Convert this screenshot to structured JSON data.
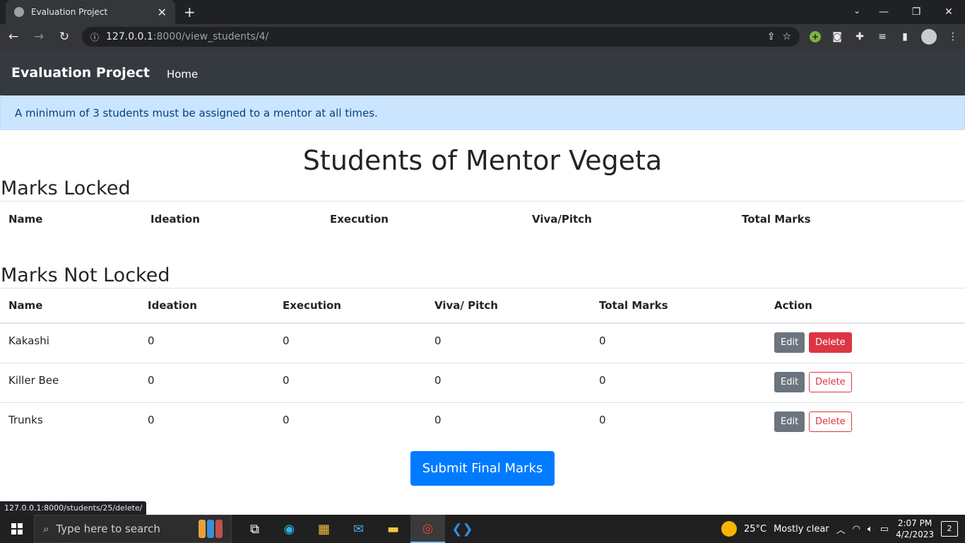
{
  "browser": {
    "tab_title": "Evaluation Project",
    "url_host": "127.0.0.1",
    "url_rest": ":8000/view_students/4/",
    "status_url": "127.0.0.1:8000/students/25/delete/"
  },
  "navbar": {
    "brand": "Evaluation Project",
    "home": "Home"
  },
  "alert": {
    "text": "A minimum of 3 students must be assigned to a mentor at all times."
  },
  "page": {
    "title": "Students of Mentor Vegeta"
  },
  "locked": {
    "heading": "Marks Locked",
    "columns": [
      "Name",
      "Ideation",
      "Execution",
      "Viva/Pitch",
      "Total Marks"
    ]
  },
  "not_locked": {
    "heading": "Marks Not Locked",
    "columns": [
      "Name",
      "Ideation",
      "Execution",
      "Viva/ Pitch",
      "Total Marks",
      "Action"
    ],
    "rows": [
      {
        "name": "Kakashi",
        "ideation": "0",
        "execution": "0",
        "viva": "0",
        "total": "0"
      },
      {
        "name": "Killer Bee",
        "ideation": "0",
        "execution": "0",
        "viva": "0",
        "total": "0"
      },
      {
        "name": "Trunks",
        "ideation": "0",
        "execution": "0",
        "viva": "0",
        "total": "0"
      }
    ],
    "edit_label": "Edit",
    "delete_label": "Delete"
  },
  "submit_label": "Submit Final Marks",
  "taskbar": {
    "search_placeholder": "Type here to search",
    "weather_temp": "25°C",
    "weather_desc": "Mostly clear",
    "time": "2:07 PM",
    "date": "4/2/2023",
    "notifications": "2"
  },
  "colors": {
    "navbar": "#343a40",
    "alert_bg": "#cce5ff",
    "primary": "#007bff",
    "danger": "#dc3545",
    "secondary": "#6c757d"
  }
}
